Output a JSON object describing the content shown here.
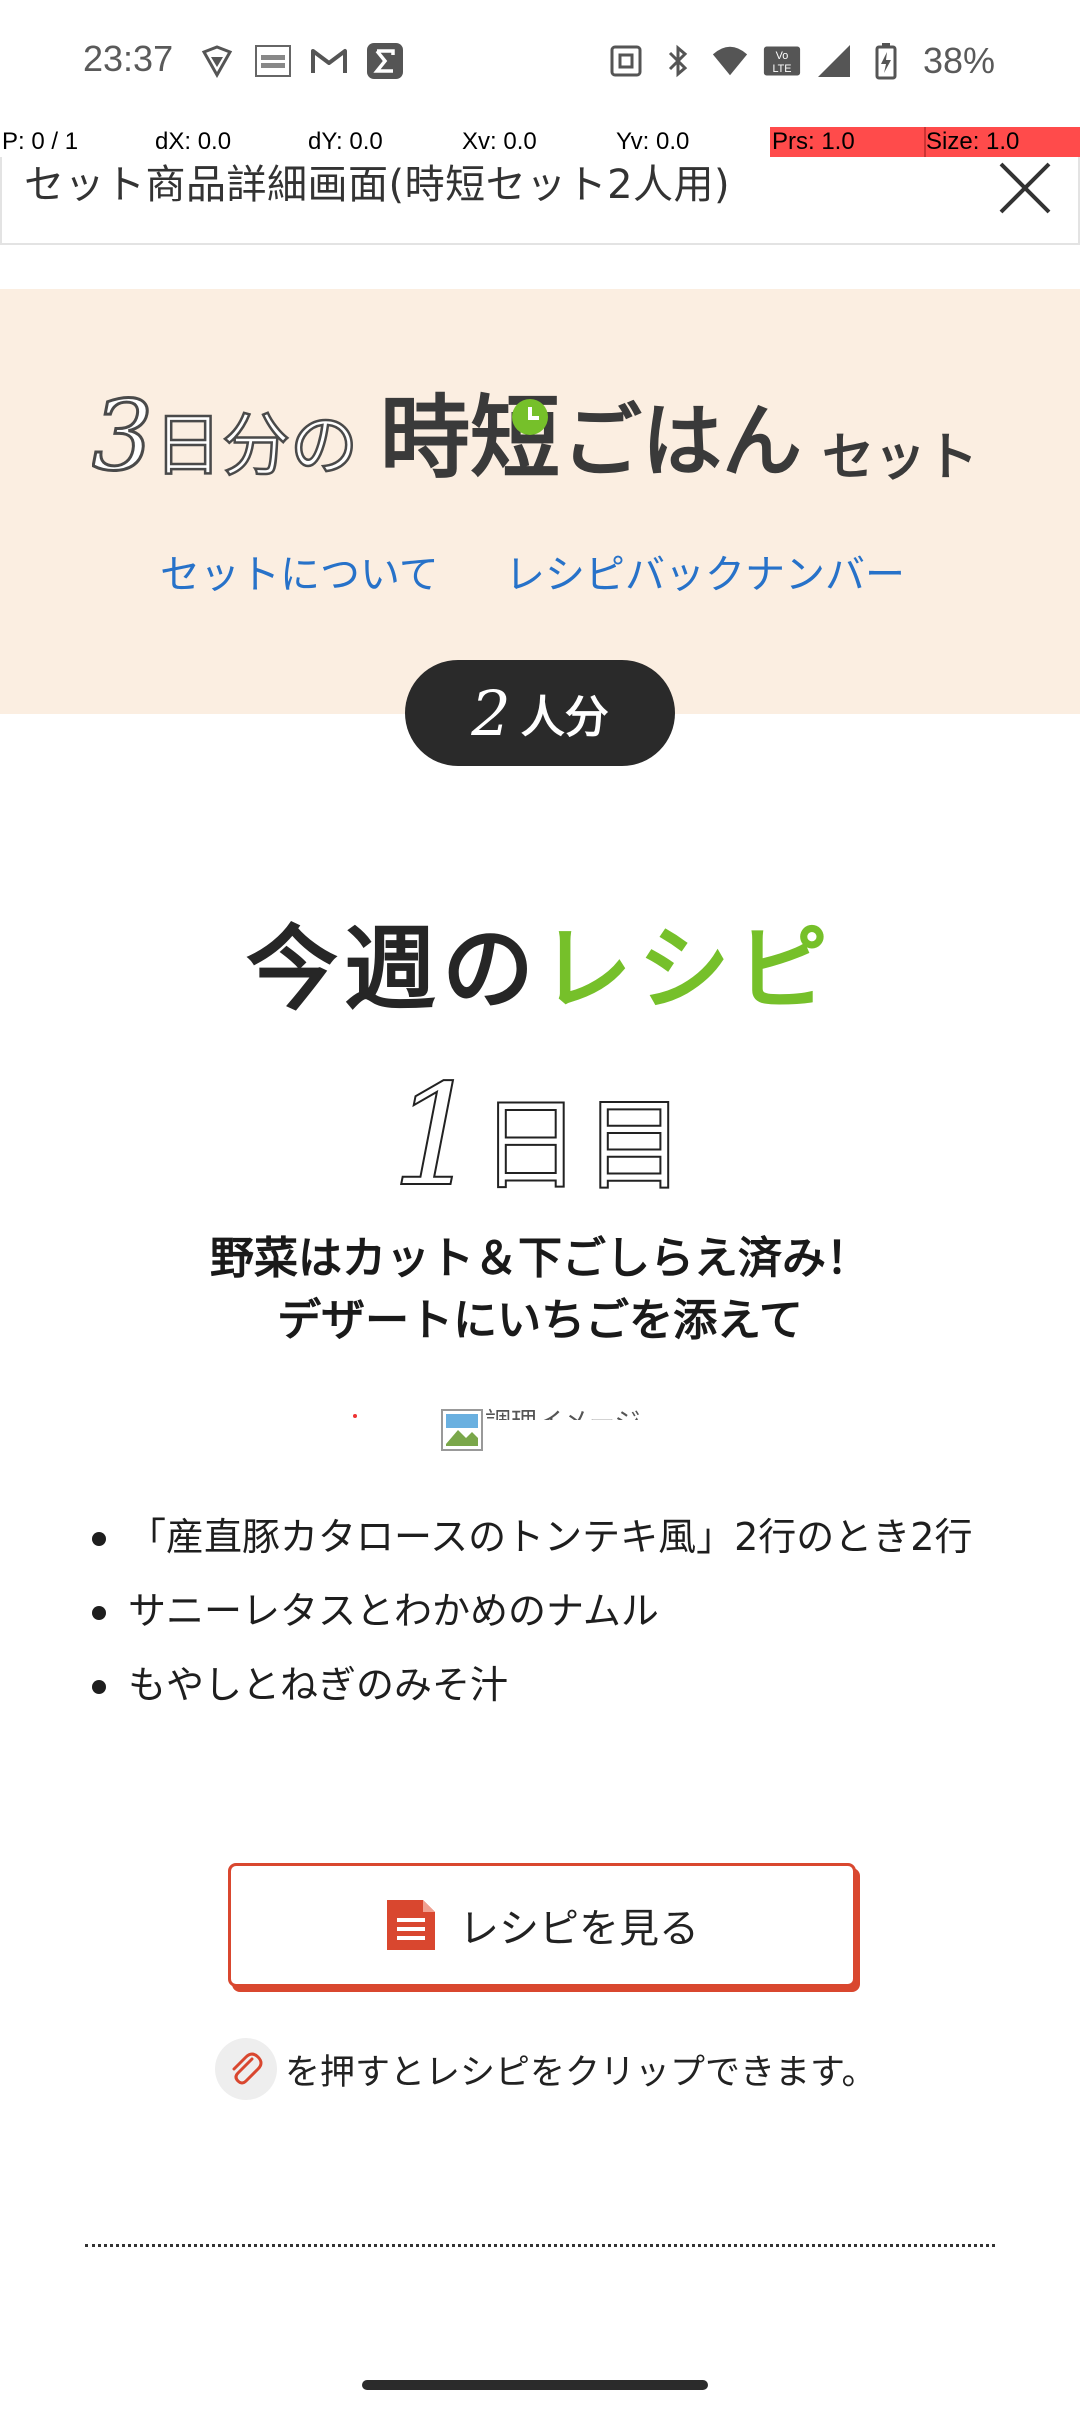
{
  "status_bar": {
    "time": "23:37",
    "battery_percent": "38%",
    "left_icons": [
      "shield-notification-icon",
      "sports-bull-icon",
      "gmail-icon",
      "sigma-app-icon"
    ],
    "right_icons": [
      "nfc-icon",
      "bluetooth-icon",
      "wifi-icon",
      "volte-icon",
      "cell-signal-icon",
      "battery-charging-icon"
    ]
  },
  "debug": {
    "p": "P: 0 / 1",
    "dx": "dX: 0.0",
    "dy": "dY: 0.0",
    "xv": "Xv: 0.0",
    "yv": "Yv: 0.0",
    "prs": "Prs: 1.0",
    "size": "Size: 1.0",
    "highlight_color": "#ff4b4b"
  },
  "title_bar": {
    "title": "セット商品詳細画面(時短セット2人用)",
    "close_icon": "close-icon"
  },
  "hero": {
    "logo_num": "3",
    "logo_small": "日分の",
    "logo_big_a": "時",
    "logo_big_b": "短",
    "logo_big_c": "ごはん",
    "logo_suffix": "セット",
    "links": [
      "セットについて",
      "レシピバックナンバー"
    ],
    "servings_num": "2",
    "servings_unit": "人分",
    "bg_color": "#fbeee1",
    "link_color": "#2772c9"
  },
  "section": {
    "title_prefix": "今週の",
    "title_accent": "レシピ",
    "accent_color": "#76c02a"
  },
  "day": {
    "num": "1",
    "unit": "日目",
    "headline_line1": "野菜はカット＆下ごしらえ済み！",
    "headline_line2": "デザートにいちごを添えて",
    "image_alt_fragment": "調理イメージ"
  },
  "recipes": [
    "「産直豚カタロースのトンテキ風」2行のとき2行",
    "サニーレタスとわかめのナムル",
    "もやしとねぎのみそ汁"
  ],
  "actions": {
    "recipe_button_label": "レシピを見る",
    "clip_note": "を押すとレシピをクリップできます。",
    "button_color": "#d9472f"
  }
}
